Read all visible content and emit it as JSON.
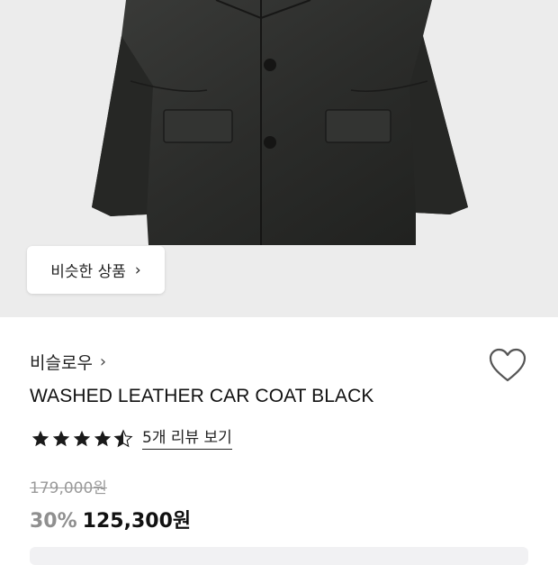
{
  "hero": {
    "image_alt": "product-photo-black-leather-coat",
    "similar_button_label": "비슷한 상품",
    "similar_button_icon": "chevron-right-icon"
  },
  "product": {
    "brand": "비슬로우",
    "brand_icon": "chevron-right-icon",
    "name": "WASHED LEATHER CAR COAT BLACK",
    "rating": 4.5,
    "review_link": "5개 리뷰 보기",
    "original_price": "179,000원",
    "discount": "30%",
    "sale_price": "125,300원"
  },
  "colors": {
    "star": "#1a1a1a",
    "discount": "#8f8f8f",
    "muted": "#9a9a9a"
  }
}
